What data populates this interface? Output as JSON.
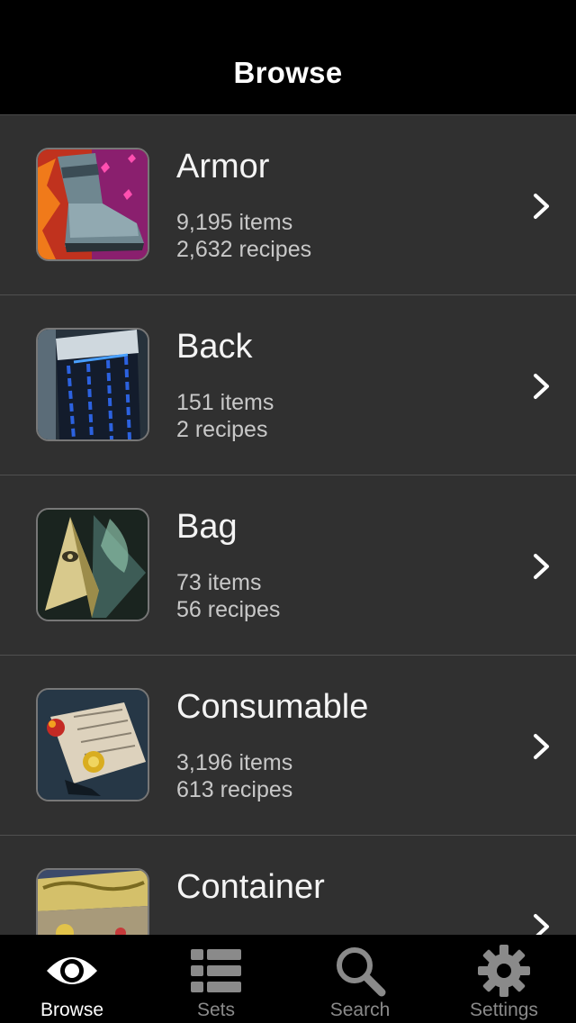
{
  "nav": {
    "title": "Browse"
  },
  "categories": [
    {
      "title": "Armor",
      "items": "9,195 items",
      "recipes": "2,632 recipes",
      "icon": "armor-boot-icon"
    },
    {
      "title": "Back",
      "items": "151 items",
      "recipes": "2 recipes",
      "icon": "back-cape-icon"
    },
    {
      "title": "Bag",
      "items": "73 items",
      "recipes": "56 recipes",
      "icon": "bag-pyramid-icon"
    },
    {
      "title": "Consumable",
      "items": "3,196 items",
      "recipes": "613 recipes",
      "icon": "consumable-scroll-icon"
    },
    {
      "title": "Container",
      "items": "",
      "recipes": "",
      "icon": "container-chest-icon"
    }
  ],
  "tabs": [
    {
      "label": "Browse",
      "icon": "eye-icon",
      "active": true
    },
    {
      "label": "Sets",
      "icon": "list-icon",
      "active": false
    },
    {
      "label": "Search",
      "icon": "magnifier-icon",
      "active": false
    },
    {
      "label": "Settings",
      "icon": "gear-icon",
      "active": false
    }
  ],
  "colors": {
    "background": "#2f2f2f",
    "navbar": "#000000",
    "tabbar": "#000000",
    "active_tab": "#ffffff",
    "inactive_tab": "#8a8a8a"
  }
}
